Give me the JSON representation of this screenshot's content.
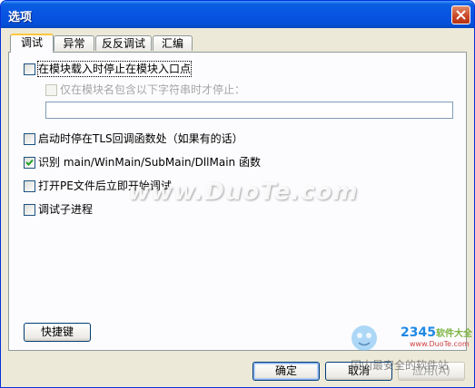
{
  "window": {
    "title": "选项"
  },
  "tabs": [
    {
      "label": "调试",
      "active": true
    },
    {
      "label": "异常",
      "active": false
    },
    {
      "label": "反反调试",
      "active": false
    },
    {
      "label": "汇编",
      "active": false
    }
  ],
  "options": [
    {
      "label": "在模块载入时停止在模块入口点",
      "checked": false,
      "enabled": true
    },
    {
      "label": "仅在模块名包含以下字符串时才停止：",
      "checked": false,
      "enabled": false
    },
    {
      "label": "启动时停在TLS回调函数处（如果有的话）",
      "checked": false,
      "enabled": true
    },
    {
      "label": "识别 main/WinMain/SubMain/DllMain 函数",
      "checked": true,
      "enabled": true
    },
    {
      "label": "打开PE文件后立即开始调试",
      "checked": false,
      "enabled": true
    },
    {
      "label": "调试子进程",
      "checked": false,
      "enabled": true
    }
  ],
  "module_name_filter": {
    "value": "",
    "placeholder": ""
  },
  "buttons": {
    "shortcut": "快捷键",
    "ok": "确定",
    "cancel": "取消",
    "apply": "应用(A)"
  },
  "watermark": {
    "site": "www.DuoTe.com",
    "logo": "2345",
    "logo_suffix": "软件大全",
    "url": "www.DuoTe.com",
    "slogan": "国内最安全的软件站"
  },
  "colors": {
    "titlebar": "#0854e3",
    "tab_highlight": "#ffc83c",
    "dialog_bg": "#ece9d8",
    "check": "#21a121"
  }
}
